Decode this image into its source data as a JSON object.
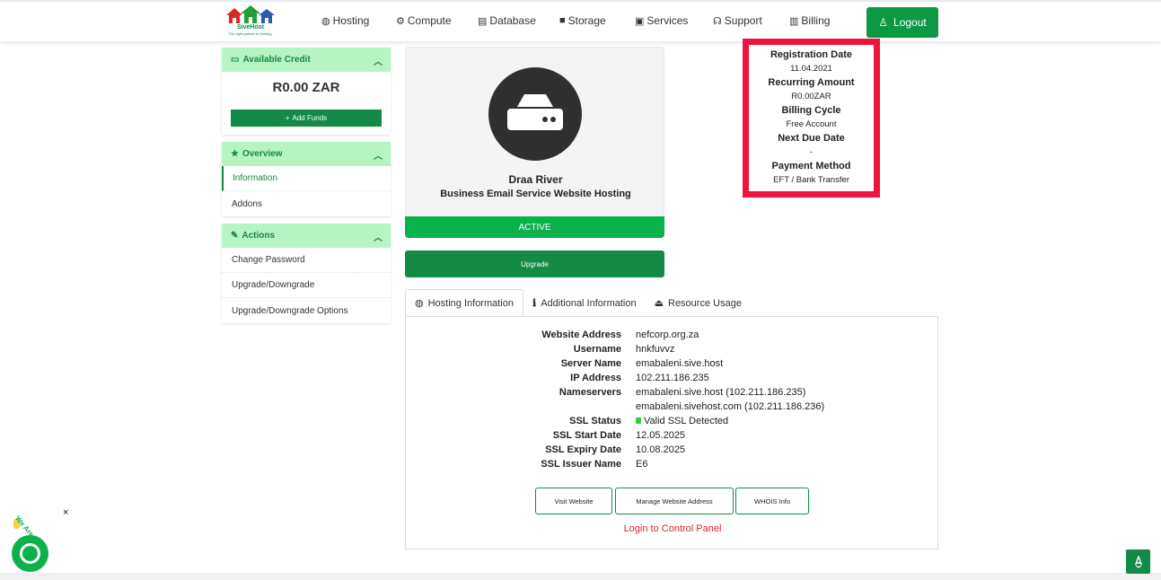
{
  "brand": {
    "name": "SiveHost",
    "tagline": "The right partner to hosting."
  },
  "nav": {
    "items": [
      {
        "label": "Hosting",
        "icon": "globe-icon"
      },
      {
        "label": "Compute",
        "icon": "cog-icon"
      },
      {
        "label": "Database",
        "icon": "database-icon"
      },
      {
        "label": "Storage",
        "icon": "cube-icon"
      },
      {
        "label": "Services",
        "icon": "gift-icon"
      },
      {
        "label": "Support",
        "icon": "headset-icon"
      },
      {
        "label": "Billing",
        "icon": "receipt-icon"
      }
    ],
    "logout_label": "Logout"
  },
  "sidebar": {
    "credit": {
      "title": "Available Credit",
      "amount": "R0.00 ZAR",
      "add_funds_label": "Add Funds"
    },
    "overview": {
      "title": "Overview",
      "items": [
        {
          "label": "Information",
          "active": true
        },
        {
          "label": "Addons"
        }
      ]
    },
    "actions": {
      "title": "Actions",
      "items": [
        {
          "label": "Change Password"
        },
        {
          "label": "Upgrade/Downgrade"
        },
        {
          "label": "Upgrade/Downgrade Options"
        }
      ]
    }
  },
  "product": {
    "name": "Draa River",
    "group": "Business Email Service Website Hosting",
    "status": "ACTIVE",
    "upgrade_label": "Upgrade"
  },
  "billing": {
    "registration_date_label": "Registration Date",
    "registration_date": "11.04.2021",
    "recurring_amount_label": "Recurring Amount",
    "recurring_amount": "R0.00ZAR",
    "billing_cycle_label": "Billing Cycle",
    "billing_cycle": "Free Account",
    "next_due_date_label": "Next Due Date",
    "next_due_date": "-",
    "payment_method_label": "Payment Method",
    "payment_method": "EFT / Bank Transfer"
  },
  "tabs": [
    {
      "label": "Hosting Information",
      "active": true
    },
    {
      "label": "Additional Information"
    },
    {
      "label": "Resource Usage"
    }
  ],
  "hosting_info": {
    "rows": [
      {
        "label": "Website Address",
        "value": "nefcorp.org.za"
      },
      {
        "label": "Username",
        "value": "hnkfuvvz"
      },
      {
        "label": "Server Name",
        "value": "emabaleni.sive.host"
      },
      {
        "label": "IP Address",
        "value": "102.211.186.235"
      },
      {
        "label": "Nameservers",
        "value": "emabaleni.sive.host (102.211.186.235)"
      },
      {
        "label": "",
        "value": "emabaleni.sivehost.com (102.211.186.236)"
      },
      {
        "label": "SSL Status",
        "value": "Valid SSL Detected"
      },
      {
        "label": "SSL Start Date",
        "value": "12.05.2025"
      },
      {
        "label": "SSL Expiry Date",
        "value": "10.08.2025"
      },
      {
        "label": "SSL Issuer Name",
        "value": "E6"
      }
    ],
    "buttons": {
      "visit": "Visit Website",
      "manage": "Manage Website Address",
      "whois": "WHOIS Info"
    },
    "control_panel_link": "Login to Control Panel"
  },
  "chat": {
    "close": "×",
    "bubble": "We Are Here!"
  }
}
